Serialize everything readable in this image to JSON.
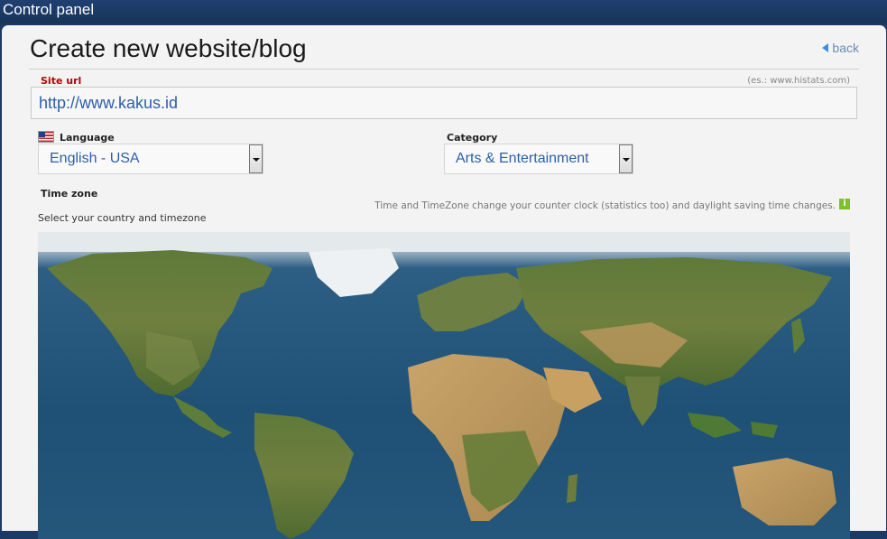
{
  "header": {
    "title": "Control panel"
  },
  "page": {
    "title": "Create new website/blog",
    "back_label": "back"
  },
  "site_url": {
    "label": "Site url",
    "hint": "(es.: www.histats.com)",
    "value": "http://www.kakus.id"
  },
  "language": {
    "label": "Language",
    "selected": "English - USA"
  },
  "category": {
    "label": "Category",
    "selected": "Arts & Entertainment"
  },
  "timezone": {
    "label": "Time zone",
    "instruction": "Select your country and timezone",
    "note": "Time and TimeZone change your counter clock (statistics too) and daylight saving time changes.",
    "info_icon": "i"
  },
  "colors": {
    "topbar": "#1c3a63",
    "link": "#2c5fa9",
    "required_label": "#c00000",
    "info_icon": "#7dbf2d",
    "ocean": "#1f5076"
  }
}
